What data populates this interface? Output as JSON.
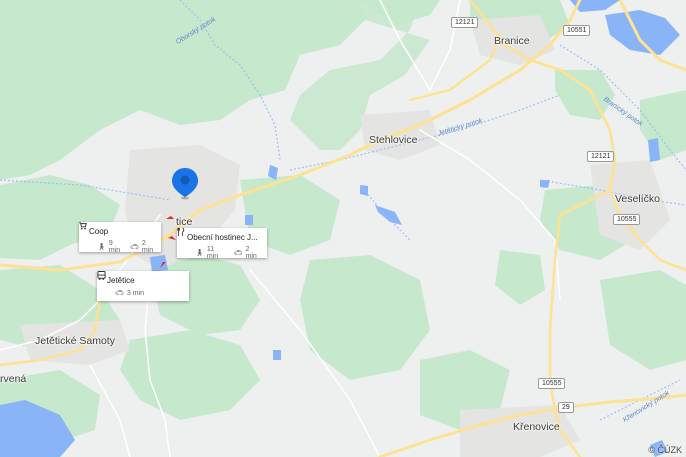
{
  "places": {
    "branice": "Branice",
    "stehlovice": "Stehlovice",
    "veselicko": "Veselíčko",
    "jetetice_village": "tice",
    "jeteticke_samoty": "Jetětické Samoty",
    "cervena": "rvená",
    "krenovice": "Křenovice"
  },
  "roads": {
    "r12121_a": "12121",
    "r10551": "10551",
    "r12121_b": "12121",
    "r10555_a": "10555",
    "r10555_b": "10555",
    "r29": "29"
  },
  "streams": {
    "oborsky": "Oborský potok",
    "jeteticky": "Jetětický potok",
    "branicky": "Branický potok",
    "krenovicky": "Křenovický potok"
  },
  "cards": {
    "coop": {
      "name": "Coop",
      "walk": "9 min",
      "drive": "2 min"
    },
    "restaurant": {
      "name": "Obecní hostinec J...",
      "walk": "11 min",
      "drive": "2 min"
    },
    "bus": {
      "name": "Jetětice",
      "drive": "3 min"
    }
  },
  "copyright": "© ČÚZK",
  "colors": {
    "forest": "#c6e8cc",
    "field": "#eef0f0",
    "water": "#8ab4f8",
    "road": "#fde293",
    "pin": "#1a73e8"
  }
}
